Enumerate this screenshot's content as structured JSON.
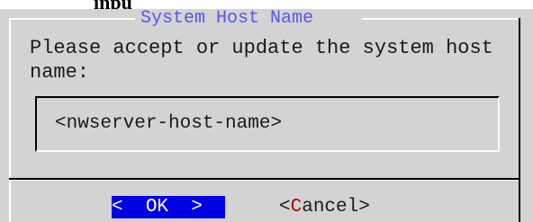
{
  "header_fragment": "inpu",
  "dialog": {
    "title": "System Host Name",
    "message": "Please accept or update the system host name:",
    "input": {
      "value": "<nwserver-host-name>"
    },
    "buttons": {
      "ok": {
        "left_bracket": "<",
        "label": "OK",
        "right_bracket": ">"
      },
      "cancel": {
        "left_bracket": "<",
        "hotkey": "C",
        "rest": "ancel",
        "right_bracket": ">"
      }
    }
  },
  "colors": {
    "dialog_bg": "#d3d3d3",
    "title": "#5858e8",
    "selected_button_bg": "#0000e0",
    "selected_button_text": "#ffffff",
    "hotkey": "#b00000"
  }
}
